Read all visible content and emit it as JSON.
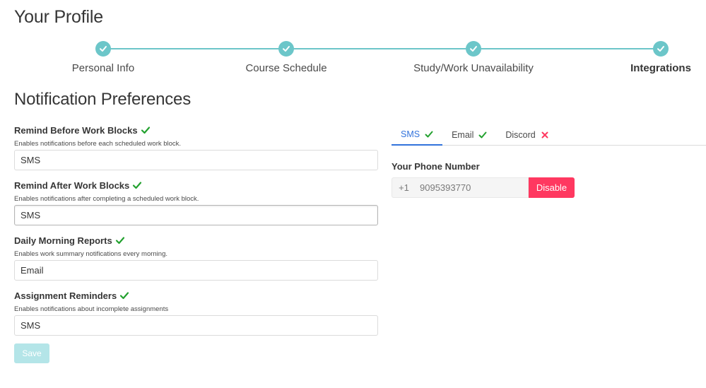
{
  "page": {
    "title": "Your Profile"
  },
  "steps": [
    {
      "label": "Personal Info",
      "active": false
    },
    {
      "label": "Course Schedule",
      "active": false
    },
    {
      "label": "Study/Work Unavailability",
      "active": false
    },
    {
      "label": "Integrations",
      "active": true
    }
  ],
  "section": {
    "title": "Notification Preferences"
  },
  "preferences": [
    {
      "label": "Remind Before Work Blocks",
      "help": "Enables notifications before each scheduled work block.",
      "value": "SMS",
      "enabled": true
    },
    {
      "label": "Remind After Work Blocks",
      "help": "Enables notifications after completing a scheduled work block.",
      "value": "SMS",
      "enabled": true
    },
    {
      "label": "Daily Morning Reports",
      "help": "Enables work summary notifications every morning.",
      "value": "Email",
      "enabled": true
    },
    {
      "label": "Assignment Reminders",
      "help": "Enables notifications about incomplete assignments",
      "value": "SMS",
      "enabled": true
    }
  ],
  "save": {
    "label": "Save"
  },
  "tabs": [
    {
      "label": "SMS",
      "status": "check",
      "active": true
    },
    {
      "label": "Email",
      "status": "check",
      "active": false
    },
    {
      "label": "Discord",
      "status": "cross",
      "active": false
    }
  ],
  "phone": {
    "label": "Your Phone Number",
    "prefix": "+1",
    "value": "9095393770",
    "disable_label": "Disable"
  },
  "colors": {
    "accent": "#6cc6c9",
    "success": "#23a12f",
    "danger": "#ff3860",
    "tab_active": "#3273dc",
    "save_disabled": "#b4e5e8"
  }
}
